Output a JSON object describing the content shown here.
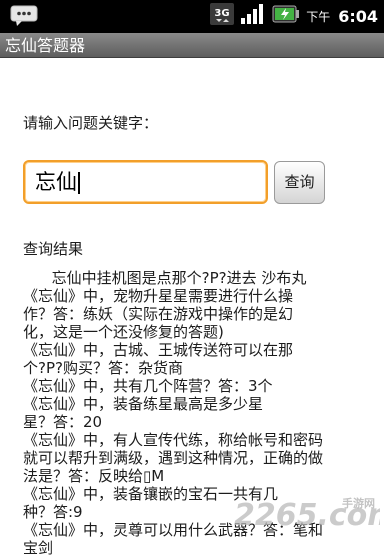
{
  "status_bar": {
    "network": "3G",
    "ampm": "下午",
    "time": "6:04"
  },
  "app": {
    "title": "忘仙答题器"
  },
  "search": {
    "prompt": "请输入问题关键字：",
    "value": "忘仙",
    "button_label": "查询"
  },
  "results": {
    "heading": "查询结果",
    "lines": [
      "      忘仙中挂机图是点那个?P?进去 沙布丸",
      " 《忘仙》中，宠物升星星需要进行什么操",
      "作？答：练妖（实际在游戏中操作的是幻",
      "化，这是一个还没修复的答题)",
      "《忘仙》中，古城、王城传送符可以在那",
      "个?P?购买？答：杂货商",
      "《忘仙》中，共有几个阵营？答：3个",
      "《忘仙》中，装备练星最高是多少星",
      "星？答：20",
      " 《忘仙》中，有人宣传代练，称给帐号和密码",
      "就可以帮升到满级，遇到这种情况，正确的做",
      "法是？答：反映给▯M",
      " 《忘仙》中，装备镶嵌的宝石一共有几",
      "种？答:9",
      " 《忘仙》中，灵尊可以用什么武器？答：笔和",
      "宝剑"
    ]
  },
  "watermark": {
    "text": "2265.com",
    "tag": "手游网"
  }
}
